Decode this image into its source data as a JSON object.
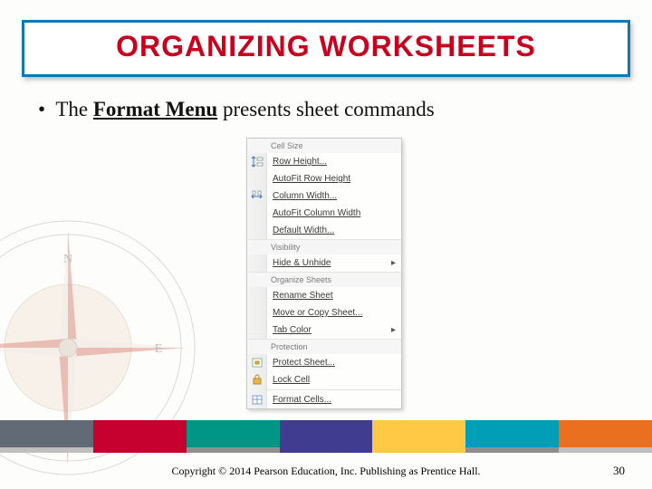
{
  "title": "ORGANIZING WORKSHEETS",
  "bullet": {
    "pre": "The ",
    "bold": "Format Menu",
    "post": " presents sheet commands"
  },
  "menu": {
    "sections": [
      {
        "header": "Cell Size",
        "items": [
          {
            "label": "Row Height...",
            "icon": "row-height"
          },
          {
            "label": "AutoFit Row Height"
          },
          {
            "label": "Column Width...",
            "icon": "col-width"
          },
          {
            "label": "AutoFit Column Width"
          },
          {
            "label": "Default Width..."
          }
        ]
      },
      {
        "header": "Visibility",
        "items": [
          {
            "label": "Hide & Unhide",
            "submenu": true
          }
        ]
      },
      {
        "header": "Organize Sheets",
        "items": [
          {
            "label": "Rename Sheet"
          },
          {
            "label": "Move or Copy Sheet..."
          },
          {
            "label": "Tab Color",
            "submenu": true
          }
        ]
      },
      {
        "header": "Protection",
        "items": [
          {
            "label": "Protect Sheet...",
            "icon": "protect"
          },
          {
            "label": "Lock Cell",
            "icon": "lock"
          },
          {
            "label": "Format Cells...",
            "icon": "format-cells"
          }
        ]
      }
    ]
  },
  "stripes": [
    "#616a75",
    "#c6002f",
    "#009685",
    "#403c90",
    "#ffc845",
    "#009fb7",
    "#ea6f1f"
  ],
  "thinbar": [
    "#bfbfbf",
    "#c6002f",
    "#8f8f8f",
    "#403c90",
    "#ffc845",
    "#8f8f8f",
    "#bfbfbf"
  ],
  "copyright": "Copyright © 2014 Pearson Education, Inc. Publishing as Prentice Hall.",
  "page": "30"
}
